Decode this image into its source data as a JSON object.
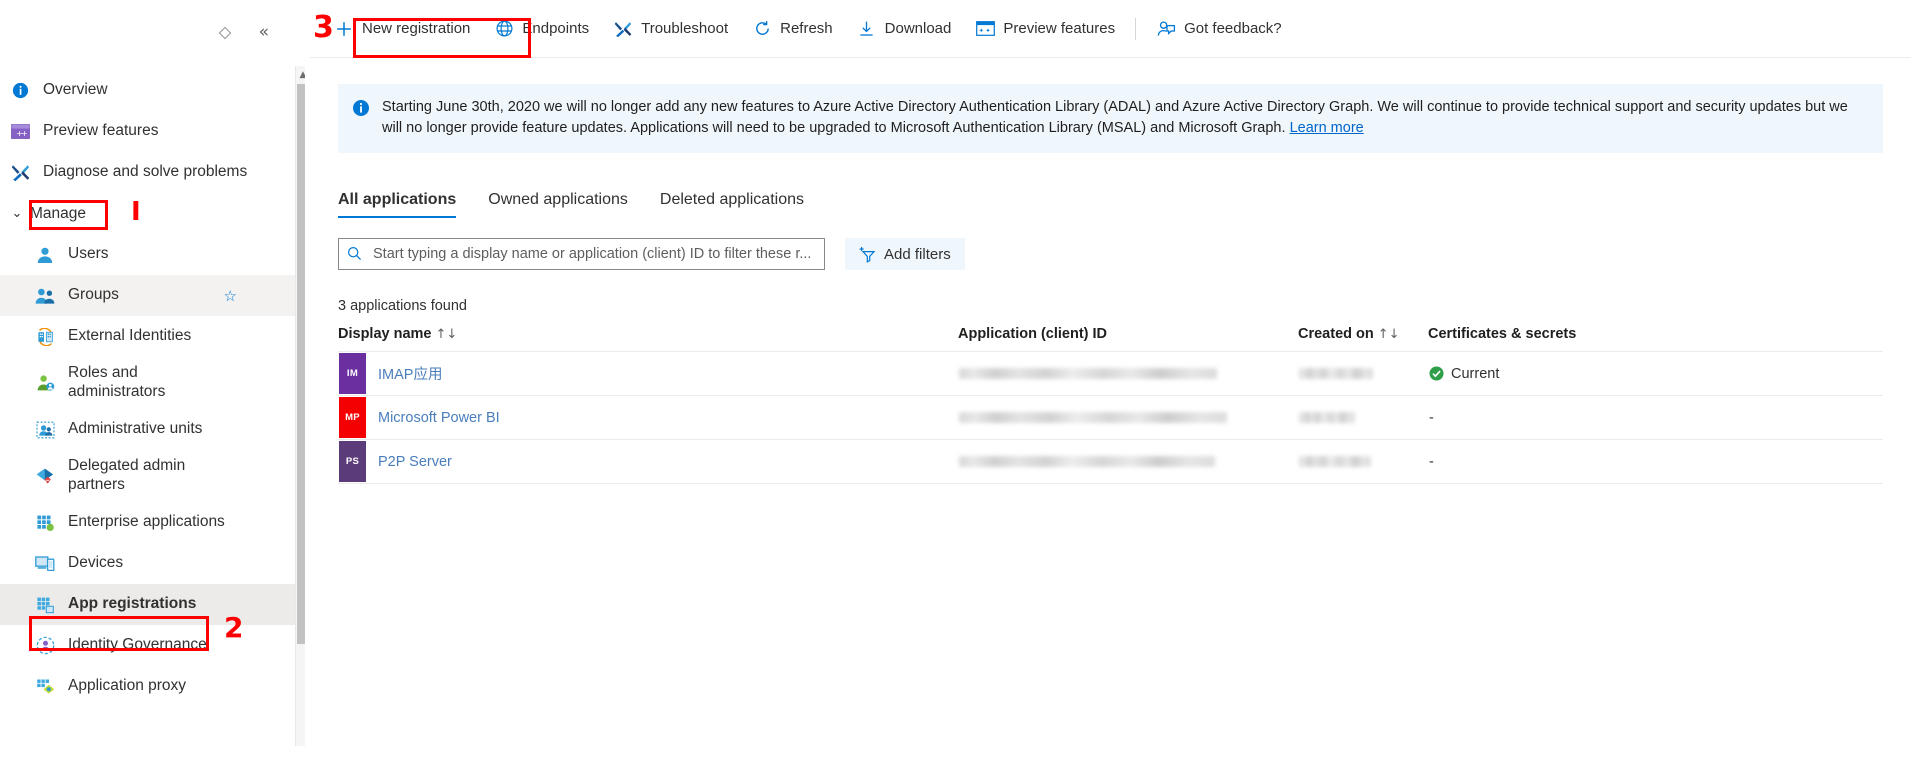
{
  "sidebar": {
    "pin_icon": "pin-diamond-icon",
    "collapse_icon": "collapse-chevrons-icon",
    "items": [
      {
        "label": "Overview",
        "icon": "info-circle-icon"
      },
      {
        "label": "Preview features",
        "icon": "preview-features-icon"
      },
      {
        "label": "Diagnose and solve problems",
        "icon": "wrench-screwdriver-icon"
      }
    ],
    "group": {
      "label": "Manage",
      "chevron": "chevron-down-icon"
    },
    "manage_items": [
      {
        "label": "Users",
        "icon": "user-icon",
        "selected": false,
        "star": false
      },
      {
        "label": "Groups",
        "icon": "groups-icon",
        "selected": false,
        "star": true
      },
      {
        "label": "External Identities",
        "icon": "external-identities-icon",
        "selected": false,
        "star": false
      },
      {
        "label": "Roles and\nadministrators",
        "icon": "roles-admin-icon",
        "selected": false,
        "star": false
      },
      {
        "label": "Administrative units",
        "icon": "administrative-units-icon",
        "selected": false,
        "star": false
      },
      {
        "label": "Delegated admin\npartners",
        "icon": "delegated-admin-icon",
        "selected": false,
        "star": false
      },
      {
        "label": "Enterprise applications",
        "icon": "enterprise-apps-icon",
        "selected": false,
        "star": false
      },
      {
        "label": "Devices",
        "icon": "devices-icon",
        "selected": false,
        "star": false
      },
      {
        "label": "App registrations",
        "icon": "app-registrations-icon",
        "selected": true,
        "star": false
      },
      {
        "label": "Identity Governance",
        "icon": "identity-governance-icon",
        "selected": false,
        "star": false
      },
      {
        "label": "Application proxy",
        "icon": "application-proxy-icon",
        "selected": false,
        "star": false
      }
    ],
    "star_glyph": "☆"
  },
  "toolbar": {
    "commands": [
      {
        "label": "New registration",
        "icon": "plus-icon"
      },
      {
        "label": "Endpoints",
        "icon": "globe-icon"
      },
      {
        "label": "Troubleshoot",
        "icon": "troubleshoot-icon"
      },
      {
        "label": "Refresh",
        "icon": "refresh-icon"
      },
      {
        "label": "Download",
        "icon": "download-icon"
      },
      {
        "label": "Preview features",
        "icon": "preview-features-icon"
      }
    ],
    "feedback": {
      "label": "Got feedback?",
      "icon": "feedback-person-icon"
    }
  },
  "banner": {
    "icon": "info-circle-icon",
    "text": "Starting June 30th, 2020 we will no longer add any new features to Azure Active Directory Authentication Library (ADAL) and Azure Active Directory Graph. We will continue to provide technical support and security updates but we will no longer provide feature updates. Applications will need to be upgraded to Microsoft Authentication Library (MSAL) and Microsoft Graph. ",
    "link_label": "Learn more"
  },
  "tabs": [
    {
      "label": "All applications",
      "active": true
    },
    {
      "label": "Owned applications",
      "active": false
    },
    {
      "label": "Deleted applications",
      "active": false
    }
  ],
  "search": {
    "icon": "search-icon",
    "value": "",
    "placeholder": "Start typing a display name or application (client) ID to filter these r..."
  },
  "add_filters": {
    "label": "Add filters",
    "icon": "add-filter-icon"
  },
  "results_count": "3 applications found",
  "table": {
    "columns": [
      {
        "label": "Display name",
        "sort": "↑↓"
      },
      {
        "label": "Application (client) ID",
        "sort": ""
      },
      {
        "label": "Created on",
        "sort": "↑↓"
      },
      {
        "label": "Certificates & secrets",
        "sort": ""
      }
    ],
    "rows": [
      {
        "initials": "IM",
        "tile_color": "#6b2fa0",
        "display_name": "IMAP应用",
        "client_id": "",
        "created_on": "",
        "certificates": "Current",
        "cert_state": "current"
      },
      {
        "initials": "MP",
        "tile_color": "#f40000",
        "display_name": "Microsoft Power BI",
        "client_id": "",
        "created_on": "",
        "certificates": "-",
        "cert_state": "none"
      },
      {
        "initials": "PS",
        "tile_color": "#5c3b7a",
        "display_name": "P2P Server",
        "client_id": "",
        "created_on": "",
        "certificates": "-",
        "cert_state": "none"
      }
    ]
  },
  "annotations": [
    {
      "name": "annotation-1",
      "label": "I",
      "target": "Manage"
    },
    {
      "name": "annotation-2",
      "label": "2",
      "target": "App registrations"
    },
    {
      "name": "annotation-3",
      "label": "3",
      "target": "New registration"
    }
  ],
  "colors": {
    "accent": "#0078d4",
    "annotation_red": "#fe0000",
    "link": "#4a7ebb",
    "banner_bg": "#eff6fc",
    "success_green": "#2e9e49"
  }
}
